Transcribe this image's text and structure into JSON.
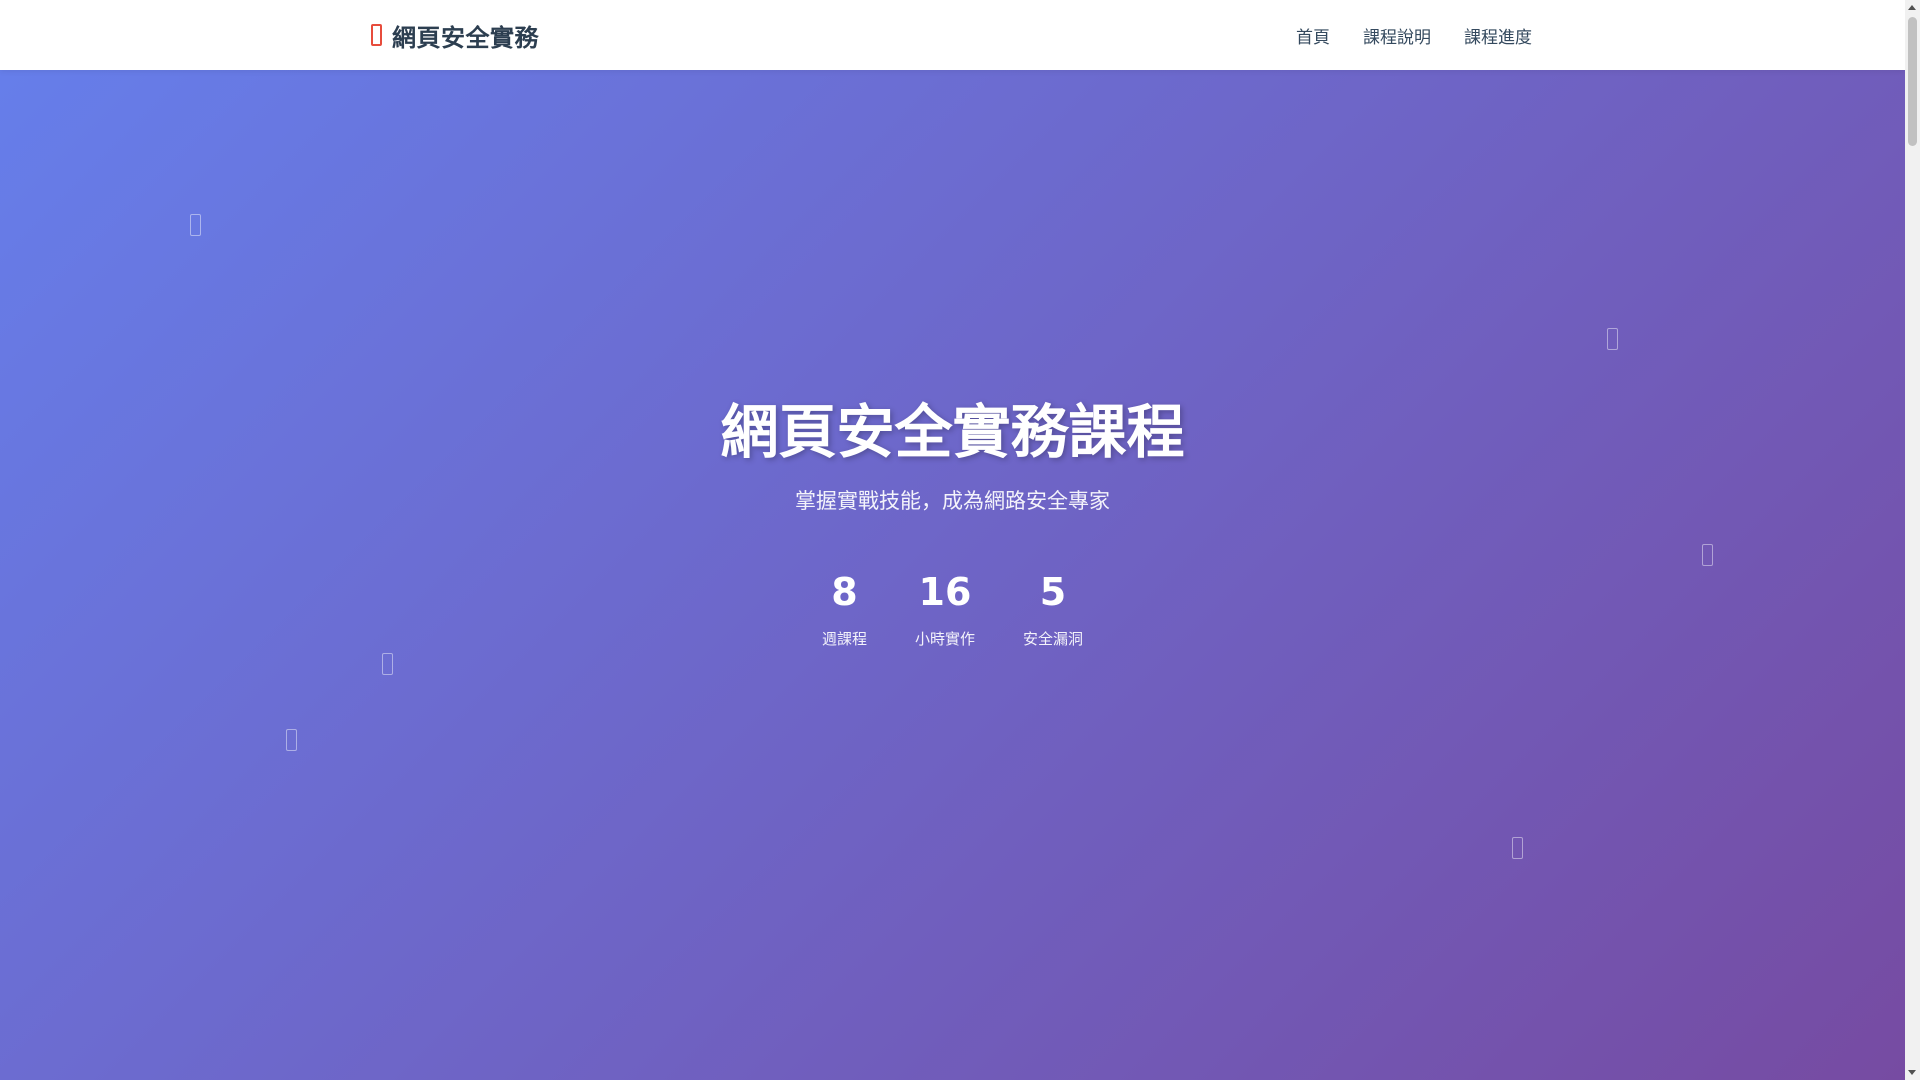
{
  "navbar": {
    "brand": "網頁安全實務",
    "links": [
      "首頁",
      "課程說明",
      "課程進度"
    ]
  },
  "hero": {
    "title": "網頁安全實務課程",
    "subtitle": "掌握實戰技能，成為網路安全專家",
    "stats": [
      {
        "number": "8",
        "label": "週課程"
      },
      {
        "number": "16",
        "label": "小時實作"
      },
      {
        "number": "5",
        "label": "安全漏洞"
      }
    ]
  },
  "colors": {
    "gradient_start": "#667eea",
    "gradient_end": "#764ba2",
    "brand_icon": "#e74c3c",
    "brand_text": "#2c3e50",
    "nav_text": "#34495e"
  },
  "icons": {
    "brand": "shield-icon",
    "floating": "shield-icon"
  }
}
